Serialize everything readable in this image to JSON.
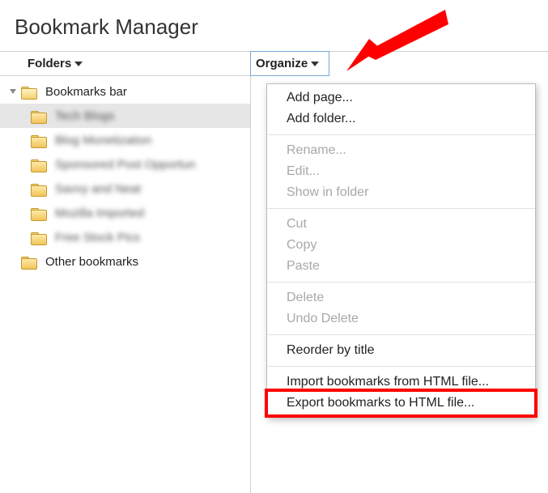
{
  "title": "Bookmark Manager",
  "sidebar": {
    "header": "Folders",
    "items": [
      {
        "label": "Bookmarks bar",
        "depth": 0,
        "open": true,
        "expander": true
      },
      {
        "label": "Tech Blogs",
        "depth": 1,
        "blurred": true,
        "selected": true
      },
      {
        "label": "Blog Monetization",
        "depth": 1,
        "blurred": true
      },
      {
        "label": "Sponsored Post Opportun",
        "depth": 1,
        "blurred": true
      },
      {
        "label": "Savvy and Neat",
        "depth": 1,
        "blurred": true
      },
      {
        "label": "Mozilla Imported",
        "depth": 1,
        "blurred": true
      },
      {
        "label": "Free Stock Pics",
        "depth": 1,
        "blurred": true
      },
      {
        "label": "Other bookmarks",
        "depth": 0
      }
    ]
  },
  "main": {
    "header": "Organize"
  },
  "menu": {
    "items": [
      {
        "label": "Add page...",
        "enabled": true
      },
      {
        "label": "Add folder...",
        "enabled": true
      },
      {
        "sep": true
      },
      {
        "label": "Rename...",
        "enabled": false
      },
      {
        "label": "Edit...",
        "enabled": false
      },
      {
        "label": "Show in folder",
        "enabled": false
      },
      {
        "sep": true
      },
      {
        "label": "Cut",
        "enabled": false
      },
      {
        "label": "Copy",
        "enabled": false
      },
      {
        "label": "Paste",
        "enabled": false
      },
      {
        "sep": true
      },
      {
        "label": "Delete",
        "enabled": false
      },
      {
        "label": "Undo Delete",
        "enabled": false
      },
      {
        "sep": true
      },
      {
        "label": "Reorder by title",
        "enabled": true
      },
      {
        "sep": true
      },
      {
        "label": "Import bookmarks from HTML file...",
        "enabled": true
      },
      {
        "label": "Export bookmarks to HTML file...",
        "enabled": true,
        "highlighted": true
      }
    ]
  },
  "annotations": {
    "highlight_color": "#ff0000",
    "arrow_color": "#ff0000"
  }
}
